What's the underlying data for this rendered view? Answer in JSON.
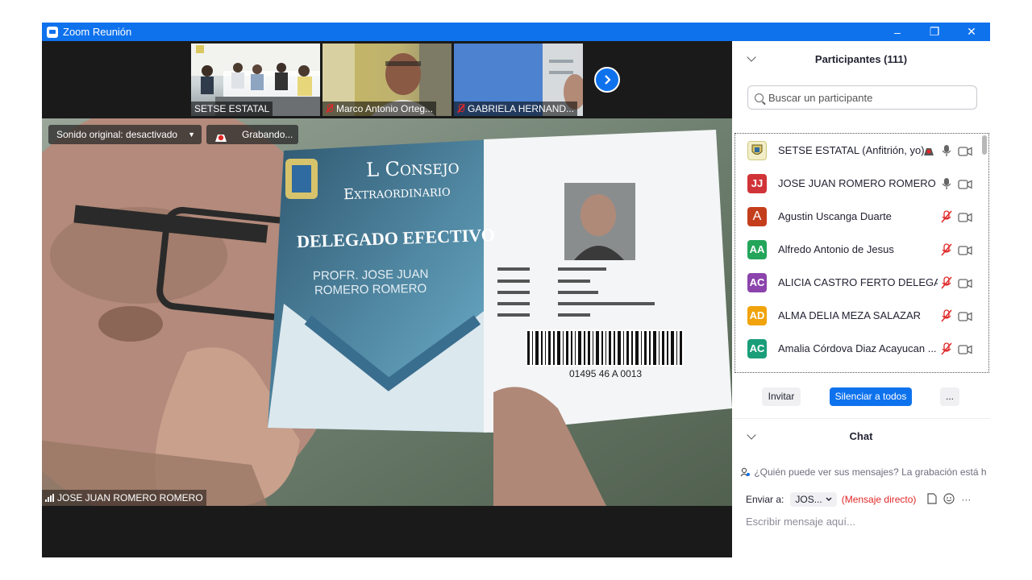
{
  "window": {
    "title": "Zoom Reunión",
    "controls": {
      "minimize": "–",
      "restore": "❐",
      "close": "✕"
    }
  },
  "thumbnails": [
    {
      "name": "SETSE ESTATAL",
      "muted": false
    },
    {
      "name": "Marco Antonio Orteg...",
      "muted": true
    },
    {
      "name": "GABRIELA HERNAND...",
      "muted": true
    }
  ],
  "main_video": {
    "audio_setting": "Sonido original: desactivado",
    "recording": "Grabando...",
    "speaker": "JOSE JUAN ROMERO ROMERO",
    "card": {
      "header_line1": "L Consejo",
      "header_line2": "Extraordinario",
      "role": "DELEGADO EFECTIVO",
      "name_line1": "PROFR. JOSE JUAN",
      "name_line2": "ROMERO ROMERO",
      "barcode_number": "01495 46 A 0013"
    }
  },
  "participants": {
    "title": "Participantes (111)",
    "search_placeholder": "Buscar un participante",
    "list": [
      {
        "initials": "",
        "name": "SETSE ESTATAL (Anfitrión, yo)",
        "color": "#e8e4c8",
        "mic": "on",
        "recording": true
      },
      {
        "initials": "JJ",
        "name": "JOSE JUAN ROMERO ROMERO",
        "color": "#d13438",
        "mic": "on",
        "recording": false
      },
      {
        "initials": "A",
        "name": "Agustin Uscanga Duarte",
        "color": "#c43e1c",
        "mic": "off",
        "recording": false
      },
      {
        "initials": "AA",
        "name": "Alfredo Antonio de Jesus",
        "color": "#23a55a",
        "mic": "off",
        "recording": false
      },
      {
        "initials": "AC",
        "name": "ALICIA CASTRO FERTO DELEGAC...",
        "color": "#8b44ac",
        "mic": "off",
        "recording": false
      },
      {
        "initials": "AD",
        "name": "ALMA DELIA MEZA SALAZAR",
        "color": "#f0a30a",
        "mic": "off",
        "recording": false
      },
      {
        "initials": "AC",
        "name": "Amalia Córdova Diaz Acayucan ...",
        "color": "#1a9e7a",
        "mic": "off",
        "recording": false
      }
    ],
    "actions": {
      "invite": "Invitar",
      "mute_all": "Silenciar a todos",
      "more": "..."
    }
  },
  "chat": {
    "title": "Chat",
    "notice": "¿Quién puede ver sus mensajes? La grabación está habilit",
    "send_to_label": "Enviar a:",
    "recipient": "JOS...",
    "direct": "(Mensaje directo)",
    "more": "···",
    "input_placeholder": "Escribir mensaje aquí..."
  },
  "colors": {
    "accent": "#0e72ed",
    "mute_red": "#e02828",
    "direct_message": "#e02828"
  }
}
